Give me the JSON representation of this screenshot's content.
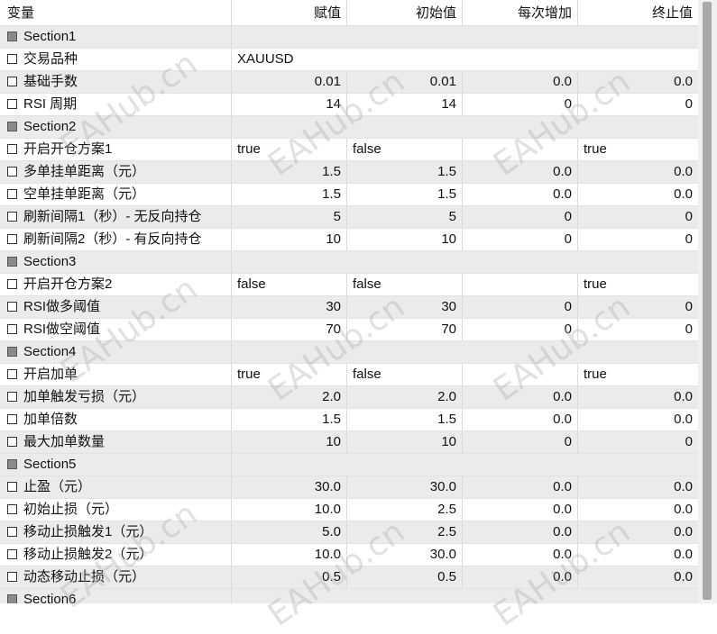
{
  "header": {
    "col_variable": "变量",
    "col_value": "赋值",
    "col_start": "初始值",
    "col_step": "每次增加",
    "col_stop": "终止值"
  },
  "rows": [
    {
      "kind": "section",
      "name": "Section1"
    },
    {
      "kind": "string",
      "name": "交易品种",
      "value": "XAUUSD"
    },
    {
      "kind": "num",
      "name": "基础手数",
      "value": "0.01",
      "start": "0.01",
      "step": "0.0",
      "stop": "0.0"
    },
    {
      "kind": "num",
      "name": "RSI 周期",
      "value": "14",
      "start": "14",
      "step": "0",
      "stop": "0"
    },
    {
      "kind": "section",
      "name": "Section2"
    },
    {
      "kind": "bool",
      "name": "开启开仓方案1",
      "value": "true",
      "start": "false",
      "step": "",
      "stop": "true"
    },
    {
      "kind": "num",
      "name": "多单挂单距离（元）",
      "value": "1.5",
      "start": "1.5",
      "step": "0.0",
      "stop": "0.0"
    },
    {
      "kind": "num",
      "name": "空单挂单距离（元）",
      "value": "1.5",
      "start": "1.5",
      "step": "0.0",
      "stop": "0.0"
    },
    {
      "kind": "num",
      "name": "刷新间隔1（秒）- 无反向持仓",
      "value": "5",
      "start": "5",
      "step": "0",
      "stop": "0"
    },
    {
      "kind": "num",
      "name": "刷新间隔2（秒）- 有反向持仓",
      "value": "10",
      "start": "10",
      "step": "0",
      "stop": "0"
    },
    {
      "kind": "section",
      "name": "Section3"
    },
    {
      "kind": "bool",
      "name": "开启开仓方案2",
      "value": "false",
      "start": "false",
      "step": "",
      "stop": "true"
    },
    {
      "kind": "num",
      "name": "RSI做多阈值",
      "value": "30",
      "start": "30",
      "step": "0",
      "stop": "0"
    },
    {
      "kind": "num",
      "name": "RSI做空阈值",
      "value": "70",
      "start": "70",
      "step": "0",
      "stop": "0"
    },
    {
      "kind": "section",
      "name": "Section4"
    },
    {
      "kind": "bool",
      "name": "开启加单",
      "value": "true",
      "start": "false",
      "step": "",
      "stop": "true"
    },
    {
      "kind": "num",
      "name": "加单触发亏损（元）",
      "value": "2.0",
      "start": "2.0",
      "step": "0.0",
      "stop": "0.0"
    },
    {
      "kind": "num",
      "name": "加单倍数",
      "value": "1.5",
      "start": "1.5",
      "step": "0.0",
      "stop": "0.0"
    },
    {
      "kind": "num",
      "name": "最大加单数量",
      "value": "10",
      "start": "10",
      "step": "0",
      "stop": "0"
    },
    {
      "kind": "section",
      "name": "Section5"
    },
    {
      "kind": "num",
      "name": "止盈（元）",
      "value": "30.0",
      "start": "30.0",
      "step": "0.0",
      "stop": "0.0"
    },
    {
      "kind": "num",
      "name": "初始止损（元）",
      "value": "10.0",
      "start": "2.5",
      "step": "0.0",
      "stop": "0.0"
    },
    {
      "kind": "num",
      "name": "移动止损触发1（元）",
      "value": "5.0",
      "start": "2.5",
      "step": "0.0",
      "stop": "0.0"
    },
    {
      "kind": "num",
      "name": "移动止损触发2（元）",
      "value": "10.0",
      "start": "30.0",
      "step": "0.0",
      "stop": "0.0"
    },
    {
      "kind": "num",
      "name": "动态移动止损（元）",
      "value": "0.5",
      "start": "0.5",
      "step": "0.0",
      "stop": "0.0"
    },
    {
      "kind": "section",
      "name": "Section6"
    }
  ],
  "watermark": "EAHub.cn",
  "colors": {
    "section_bg": "#ebebeb",
    "alt_bg": "#ebebeb",
    "grid_line": "#dcdcdc",
    "scroll_thumb": "#a9a9a9"
  }
}
